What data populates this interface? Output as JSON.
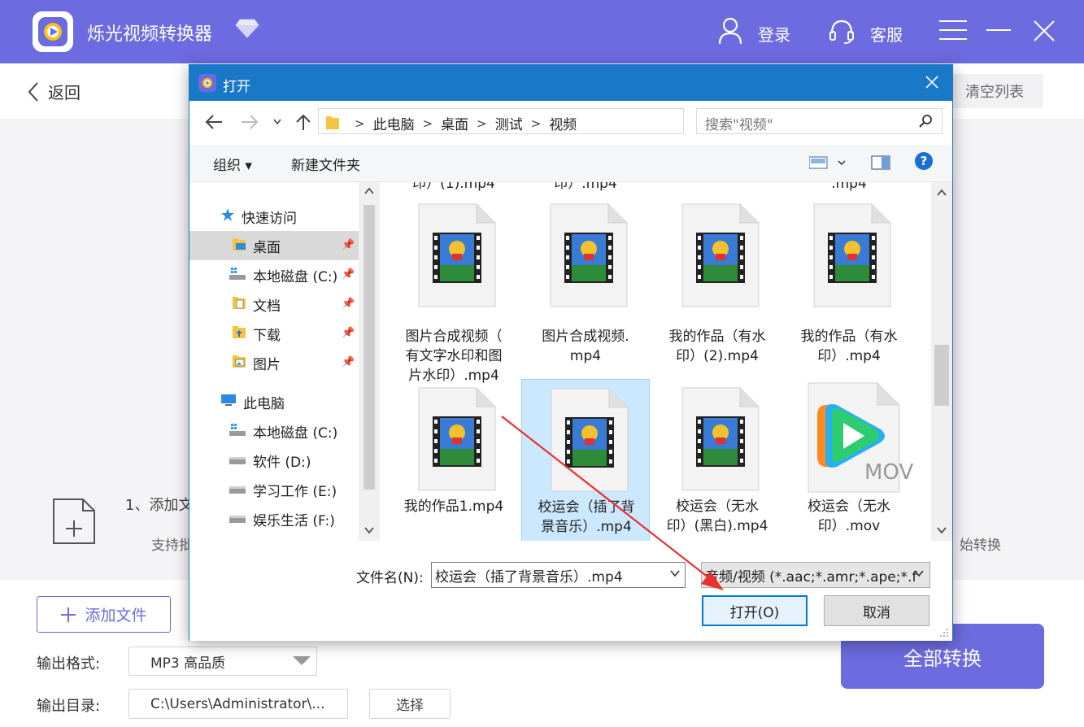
{
  "app": {
    "title": "烁光视频转换器",
    "login": "登录",
    "service": "客服",
    "accent": "#6c6bdf"
  },
  "header": {
    "back": "返回",
    "clear_list": "清空列表"
  },
  "drop_zone": {
    "hint1": "1、添加文",
    "hint2": "支持批",
    "hint3": "始转换"
  },
  "bottom": {
    "add_file": "添加文件",
    "format_label": "输出格式:",
    "format_value": "MP3 高品质",
    "outdir_label": "输出目录:",
    "outdir_value": "C:\\Users\\Administrator\\...",
    "select": "选择",
    "convert_all": "全部转换"
  },
  "dialog": {
    "title": "打开",
    "breadcrumb": [
      "此电脑",
      "桌面",
      "测试",
      "视频"
    ],
    "search_placeholder": "搜索\"视频\"",
    "organize": "组织 ▾",
    "new_folder": "新建文件夹",
    "help": "?",
    "nav": {
      "quick_access": "快速访问",
      "desktop": "桌面",
      "local_c_quick": "本地磁盘 (C:)",
      "documents": "文档",
      "downloads": "下载",
      "pictures": "图片",
      "this_pc": "此电脑",
      "local_c": "本地磁盘 (C:)",
      "soft_d": "软件 (D:)",
      "study_e": "学习工作 (E:)",
      "fun_f": "娱乐生活 (F:)"
    },
    "cut_labels": [
      "印）(1).mp4",
      "印）.mp4",
      ".mp4"
    ],
    "files": [
      {
        "l1": "图片合成视频（",
        "l2": "有文字水印和图",
        "l3": "片水印）.mp4"
      },
      {
        "l1": "图片合成视频.",
        "l2": "mp4",
        "l3": ""
      },
      {
        "l1": "我的作品（有水",
        "l2": "印）(2).mp4",
        "l3": ""
      },
      {
        "l1": "我的作品（有水",
        "l2": "印）.mp4",
        "l3": ""
      },
      {
        "l1": "我的作品1.mp4",
        "l2": "",
        "l3": ""
      },
      {
        "l1": "校运会（插了背",
        "l2": "景音乐）.mp4",
        "l3": ""
      },
      {
        "l1": "校运会（无水",
        "l2": "印）(黑白).mp4",
        "l3": ""
      },
      {
        "l1": "校运会（无水",
        "l2": "印）.mov",
        "l3": ""
      }
    ],
    "mov_badge": "MOV",
    "filename_label": "文件名(N):",
    "filename_value": "校运会（插了背景音乐）.mp4",
    "filetype_value": "音频/视频 (*.aac;*.amr;*.ape;*.f",
    "open": "打开(O)",
    "cancel": "取消"
  }
}
